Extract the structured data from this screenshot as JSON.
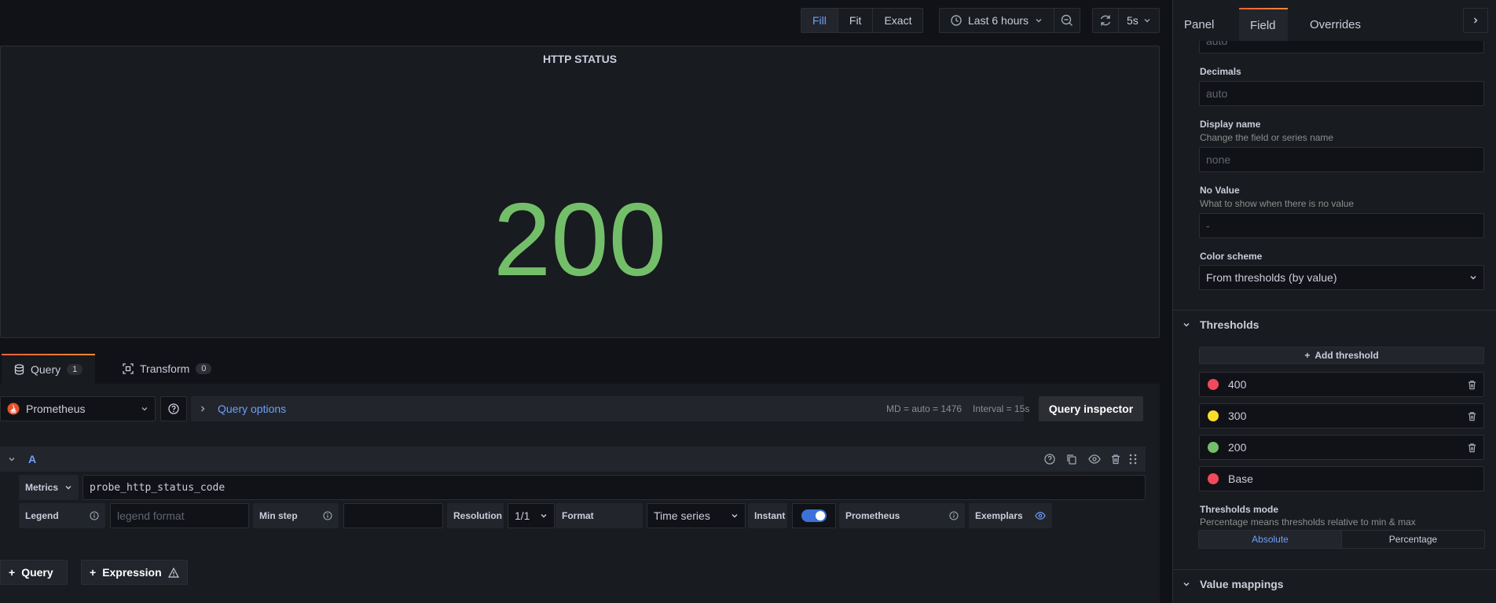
{
  "toolbar": {
    "fill": "Fill",
    "fit": "Fit",
    "exact": "Exact",
    "time_range": "Last 6 hours",
    "refresh_interval": "5s"
  },
  "panel": {
    "title": "HTTP STATUS",
    "value": "200",
    "value_color": "#73bf69"
  },
  "query_tabs": {
    "query_label": "Query",
    "query_count": "1",
    "transform_label": "Transform",
    "transform_count": "0"
  },
  "query_row": {
    "datasource": "Prometheus",
    "options_label": "Query options",
    "md_info": "MD = auto = 1476",
    "interval_info": "Interval = 15s",
    "inspector_label": "Query inspector"
  },
  "query_a": {
    "ref_id": "A",
    "metrics_label": "Metrics",
    "metric_expr": "probe_http_status_code",
    "legend_label": "Legend",
    "legend_placeholder": "legend format",
    "min_step_label": "Min step",
    "resolution_label": "Resolution",
    "resolution_value": "1/1",
    "format_label": "Format",
    "format_value": "Time series",
    "instant_label": "Instant",
    "prometheus_label": "Prometheus",
    "exemplars_label": "Exemplars"
  },
  "add_buttons": {
    "query": "Query",
    "expression": "Expression"
  },
  "sidebar": {
    "tabs": [
      "Panel",
      "Field",
      "Overrides"
    ],
    "top_input_placeholder": "auto",
    "decimals_label": "Decimals",
    "decimals_placeholder": "auto",
    "display_name_label": "Display name",
    "display_name_desc": "Change the field or series name",
    "display_name_placeholder": "none",
    "no_value_label": "No Value",
    "no_value_desc": "What to show when there is no value",
    "no_value_placeholder": "-",
    "color_scheme_label": "Color scheme",
    "color_scheme_value": "From thresholds (by value)",
    "thresholds_title": "Thresholds",
    "add_threshold": "Add threshold",
    "thresholds": [
      {
        "value": "400",
        "color": "#f2495c"
      },
      {
        "value": "300",
        "color": "#fade2a"
      },
      {
        "value": "200",
        "color": "#73bf69"
      },
      {
        "value": "Base",
        "color": "#f2495c"
      }
    ],
    "thresholds_mode_label": "Thresholds mode",
    "thresholds_mode_desc": "Percentage means thresholds relative to min & max",
    "mode_absolute": "Absolute",
    "mode_percentage": "Percentage",
    "value_mappings_title": "Value mappings"
  }
}
